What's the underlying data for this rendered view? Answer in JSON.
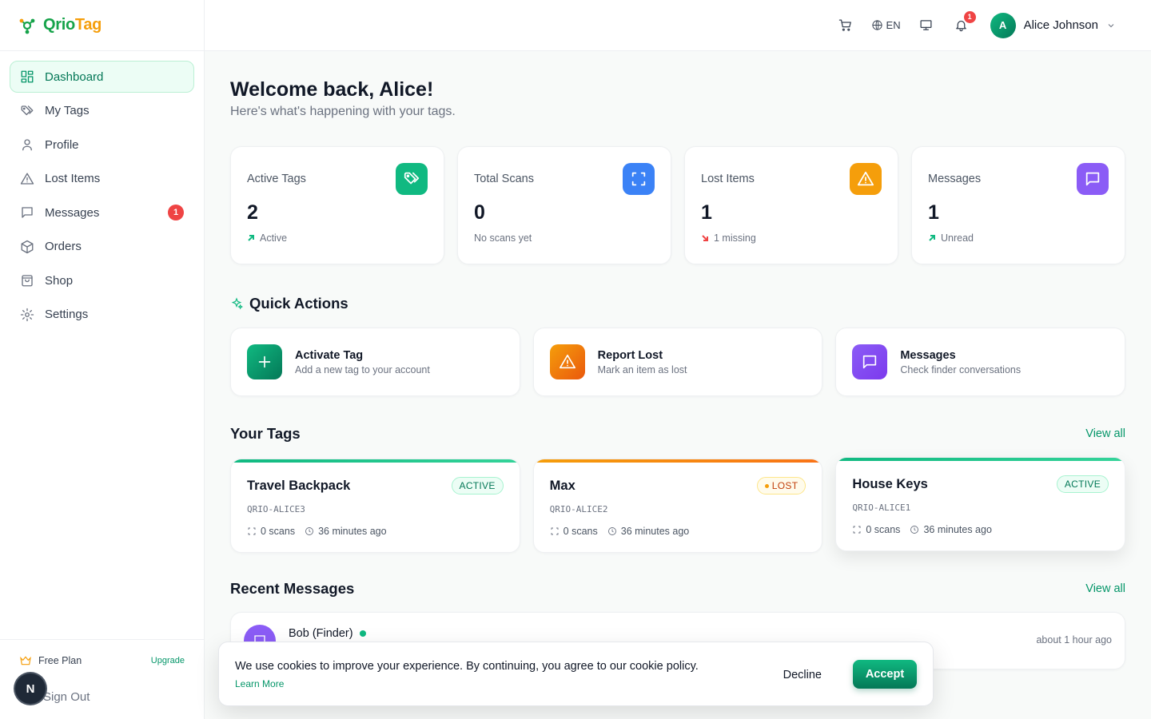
{
  "brand": {
    "part1": "Qrio",
    "part2": "Tag"
  },
  "sidebar": {
    "items": [
      {
        "label": "Dashboard"
      },
      {
        "label": "My Tags"
      },
      {
        "label": "Profile"
      },
      {
        "label": "Lost Items"
      },
      {
        "label": "Messages",
        "badge": "1"
      },
      {
        "label": "Orders"
      },
      {
        "label": "Shop"
      },
      {
        "label": "Settings"
      }
    ],
    "plan": "Free Plan",
    "upgrade": "Upgrade",
    "signout": "Sign Out",
    "dev_avatar": "N"
  },
  "topbar": {
    "lang": "EN",
    "notif_count": "1",
    "user_initial": "A",
    "user_name": "Alice Johnson"
  },
  "welcome": {
    "title": "Welcome back, Alice!",
    "subtitle": "Here's what's happening with your tags."
  },
  "stats": [
    {
      "label": "Active Tags",
      "value": "2",
      "note": "Active",
      "color": "#10b981",
      "icon": "tag-icon"
    },
    {
      "label": "Total Scans",
      "value": "0",
      "note": "No scans yet",
      "color": "#3b82f6",
      "icon": "scan-icon"
    },
    {
      "label": "Lost Items",
      "value": "1",
      "note": "1 missing",
      "color": "#f59e0b",
      "icon": "warning-icon"
    },
    {
      "label": "Messages",
      "value": "1",
      "note": "Unread",
      "color": "#8b5cf6",
      "icon": "message-icon"
    }
  ],
  "quick_actions": {
    "title": "Quick Actions",
    "items": [
      {
        "name": "Activate Tag",
        "desc": "Add a new tag to your account",
        "color": "#059669"
      },
      {
        "name": "Report Lost",
        "desc": "Mark an item as lost",
        "color": "#f59e0b"
      },
      {
        "name": "Messages",
        "desc": "Check finder conversations",
        "color": "#8b5cf6"
      }
    ]
  },
  "tags": {
    "title": "Your Tags",
    "view_all": "View all",
    "items": [
      {
        "name": "Travel Backpack",
        "status": "ACTIVE",
        "code": "QRIO-ALICE3",
        "scans": "0 scans",
        "time": "36 minutes ago"
      },
      {
        "name": "Max",
        "status": "LOST",
        "code": "QRIO-ALICE2",
        "scans": "0 scans",
        "time": "36 minutes ago"
      },
      {
        "name": "House Keys",
        "status": "ACTIVE",
        "code": "QRIO-ALICE1",
        "scans": "0 scans",
        "time": "36 minutes ago"
      }
    ]
  },
  "messages": {
    "title": "Recent Messages",
    "view_all": "View all",
    "items": [
      {
        "from": "Bob (Finder)",
        "time": "about 1 hour ago"
      }
    ]
  },
  "cookie": {
    "text": "We use cookies to improve your experience. By continuing, you agree to our cookie policy.",
    "learn_more": "Learn More",
    "decline": "Decline",
    "accept": "Accept"
  }
}
